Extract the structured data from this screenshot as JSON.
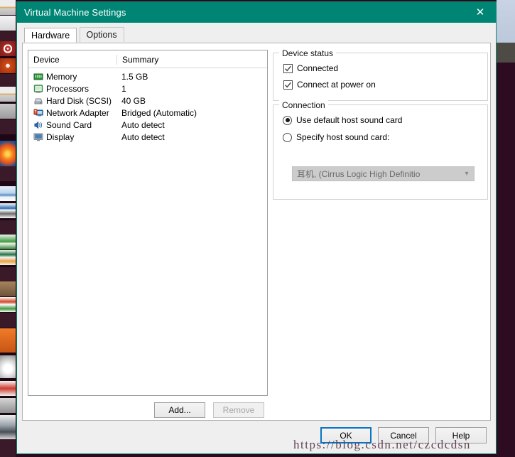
{
  "window": {
    "title": "Virtual Machine Settings",
    "close_icon": "close-icon",
    "titlebar_color": "#008575"
  },
  "tabs": [
    {
      "label": "Hardware",
      "active": true
    },
    {
      "label": "Options",
      "active": false
    }
  ],
  "device_list": {
    "columns": [
      "Device",
      "Summary"
    ],
    "rows": [
      {
        "icon": "memory-icon",
        "name": "Memory",
        "summary": "1.5 GB"
      },
      {
        "icon": "processor-icon",
        "name": "Processors",
        "summary": "1"
      },
      {
        "icon": "hard-disk-icon",
        "name": "Hard Disk (SCSI)",
        "summary": "40 GB"
      },
      {
        "icon": "network-adapter-icon",
        "name": "Network Adapter",
        "summary": "Bridged (Automatic)"
      },
      {
        "icon": "sound-card-icon",
        "name": "Sound Card",
        "summary": "Auto detect"
      },
      {
        "icon": "display-icon",
        "name": "Display",
        "summary": "Auto detect"
      }
    ],
    "add_label": "Add...",
    "remove_label": "Remove",
    "remove_enabled": false
  },
  "device_status": {
    "legend": "Device status",
    "checkboxes": [
      {
        "label": "Connected",
        "checked": true
      },
      {
        "label": "Connect at power on",
        "checked": true
      }
    ]
  },
  "connection": {
    "legend": "Connection",
    "radios": [
      {
        "label": "Use default host sound card",
        "checked": true
      },
      {
        "label": "Specify host sound card:",
        "checked": false
      }
    ],
    "dropdown": {
      "value": "耳机, (Cirrus Logic High Definitio",
      "enabled": false,
      "arrow_icon": "chevron-down-icon"
    }
  },
  "footer": {
    "buttons": [
      {
        "label": "OK",
        "default": true
      },
      {
        "label": "Cancel",
        "default": false
      },
      {
        "label": "Help",
        "default": false
      }
    ]
  },
  "watermark": {
    "text": "https://blog.csdn.net/czcdcdsn"
  },
  "dock": {
    "icons": [
      "topbar-icon",
      "text-doc-icon",
      "target-icon",
      "ubuntu-icon",
      "slide-icon",
      "box-icon",
      "firefox-icon",
      "picture-icon",
      "lines-icon",
      "green-doc-icon",
      "excel-icon",
      "ppt-icon",
      "brown-icon",
      "orange-icon",
      "cup-icon",
      "red-icon",
      "gray-icon",
      "car-icon"
    ]
  }
}
